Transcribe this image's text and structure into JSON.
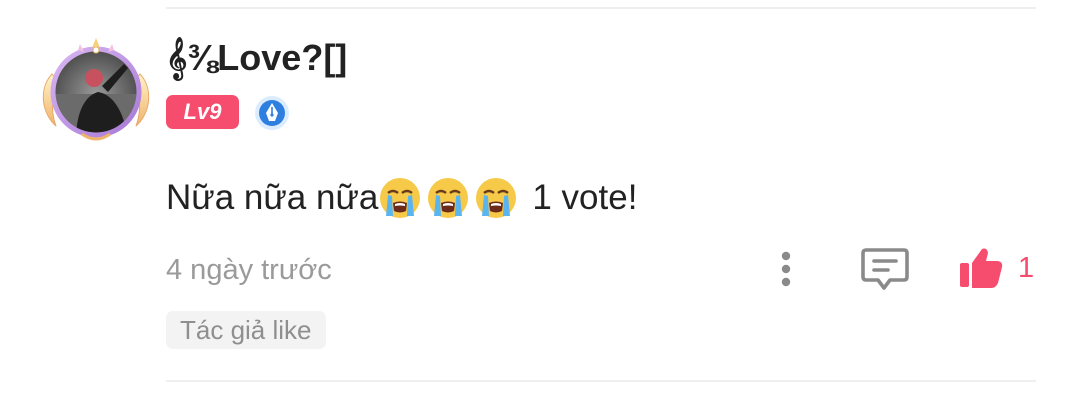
{
  "comment": {
    "username": "𝄞⅜Love?[]",
    "level_label": "Lv9",
    "body_text_before": "Nữa nữa nữa",
    "body_text_after": "1 vote!",
    "emojis": [
      "loudly-crying-face",
      "loudly-crying-face",
      "loudly-crying-face"
    ],
    "timestamp": "4 ngày trước",
    "like_count": "1",
    "author_like_label": "Tác giả like"
  },
  "colors": {
    "accent": "#f64c6e",
    "muted_text": "#9a9a9a",
    "icon_gray": "#8a8a8a",
    "badge_blue": "#2f7fe0"
  },
  "icons": {
    "avatar": "avatar-with-golden-frame",
    "writer_badge": "pen-nib-badge-icon",
    "more": "vertical-dots-icon",
    "comment": "comment-bubble-icon",
    "like": "thumbs-up-icon"
  }
}
